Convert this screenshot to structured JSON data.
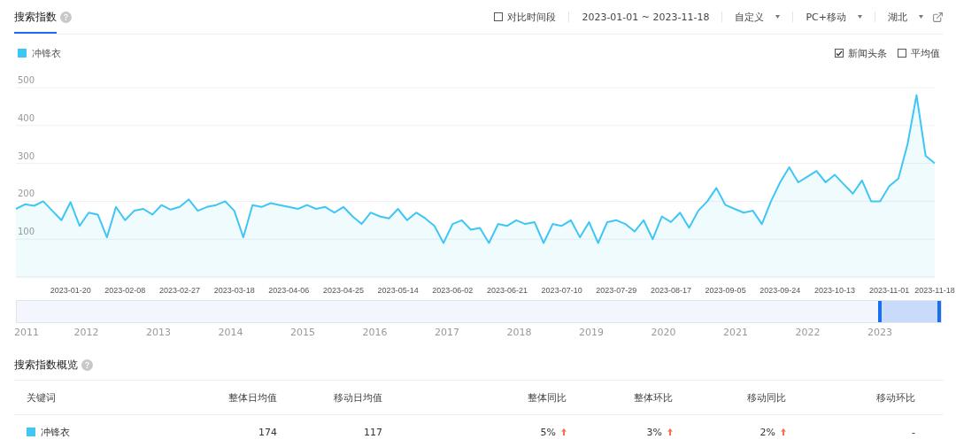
{
  "header": {
    "tabs": [
      {
        "label": "搜索指数",
        "selected": true
      }
    ],
    "compare": {
      "label": "对比时间段",
      "checked": false
    },
    "date_range": "2023-01-01 ~ 2023-11-18",
    "dropdowns": [
      {
        "label": "自定义"
      },
      {
        "label": "PC+移动"
      },
      {
        "label": "湖北"
      }
    ]
  },
  "options": [
    {
      "label": "新闻头条",
      "checked": true
    },
    {
      "label": "平均值",
      "checked": false
    }
  ],
  "chart_data": {
    "type": "area",
    "grid": true,
    "ylim": [
      0,
      500
    ],
    "yticks": [
      100,
      200,
      300,
      400,
      500
    ],
    "categories": [
      null,
      null,
      null,
      null,
      null,
      null,
      "2023-01-20",
      null,
      null,
      null,
      null,
      null,
      "2023-02-08",
      null,
      null,
      null,
      null,
      null,
      "2023-02-27",
      null,
      null,
      null,
      null,
      null,
      "2023-03-18",
      null,
      null,
      null,
      null,
      null,
      "2023-04-06",
      null,
      null,
      null,
      null,
      null,
      "2023-04-25",
      null,
      null,
      null,
      null,
      null,
      "2023-05-14",
      null,
      null,
      null,
      null,
      null,
      "2023-06-02",
      null,
      null,
      null,
      null,
      null,
      "2023-06-21",
      null,
      null,
      null,
      null,
      null,
      "2023-07-10",
      null,
      null,
      null,
      null,
      null,
      "2023-07-29",
      null,
      null,
      null,
      null,
      null,
      "2023-08-17",
      null,
      null,
      null,
      null,
      null,
      "2023-09-05",
      null,
      null,
      null,
      null,
      null,
      "2023-09-24",
      null,
      null,
      null,
      null,
      null,
      "2023-10-13",
      null,
      null,
      null,
      null,
      null,
      "2023-11-01",
      null,
      null,
      null,
      null,
      "2023-11-18"
    ],
    "series": [
      {
        "name": "冲锋衣",
        "color": "#3ec6f5",
        "values": [
          180,
          192,
          188,
          200,
          175,
          150,
          198,
          135,
          170,
          165,
          105,
          185,
          150,
          175,
          180,
          165,
          190,
          178,
          185,
          205,
          175,
          185,
          190,
          200,
          175,
          105,
          190,
          185,
          195,
          190,
          185,
          180,
          190,
          180,
          185,
          170,
          185,
          160,
          140,
          170,
          160,
          155,
          180,
          150,
          170,
          155,
          135,
          90,
          140,
          150,
          125,
          130,
          90,
          140,
          135,
          150,
          140,
          145,
          90,
          140,
          135,
          150,
          105,
          145,
          90,
          145,
          150,
          140,
          120,
          150,
          100,
          160,
          145,
          170,
          130,
          175,
          200,
          235,
          190,
          180,
          170,
          175,
          140,
          200,
          250,
          290,
          250,
          265,
          280,
          250,
          270,
          245,
          220,
          255,
          200,
          200,
          240,
          260,
          350,
          480,
          320,
          300
        ]
      }
    ]
  },
  "navigator": {
    "level": 0.068,
    "years": [
      "2011",
      "2012",
      "2013",
      "2014",
      "2015",
      "2016",
      "2017",
      "2018",
      "2019",
      "2020",
      "2021",
      "2022",
      "2023"
    ]
  },
  "overview": {
    "title": "搜索指数概览",
    "columns": [
      "关键词",
      "整体日均值",
      "移动日均值",
      "整体同比",
      "整体环比",
      "移动同比",
      "移动环比"
    ],
    "rows": [
      {
        "color": "#3ec6f5",
        "cells": [
          {
            "text": "冲锋衣",
            "kind": "plain"
          },
          {
            "text": "174",
            "kind": "plain"
          },
          {
            "text": "117",
            "kind": "plain"
          },
          {
            "text": "5%",
            "kind": "rising"
          },
          {
            "text": "3%",
            "kind": "rising"
          },
          {
            "text": "2%",
            "kind": "rising"
          },
          {
            "text": "-",
            "kind": "plain"
          }
        ]
      }
    ]
  }
}
